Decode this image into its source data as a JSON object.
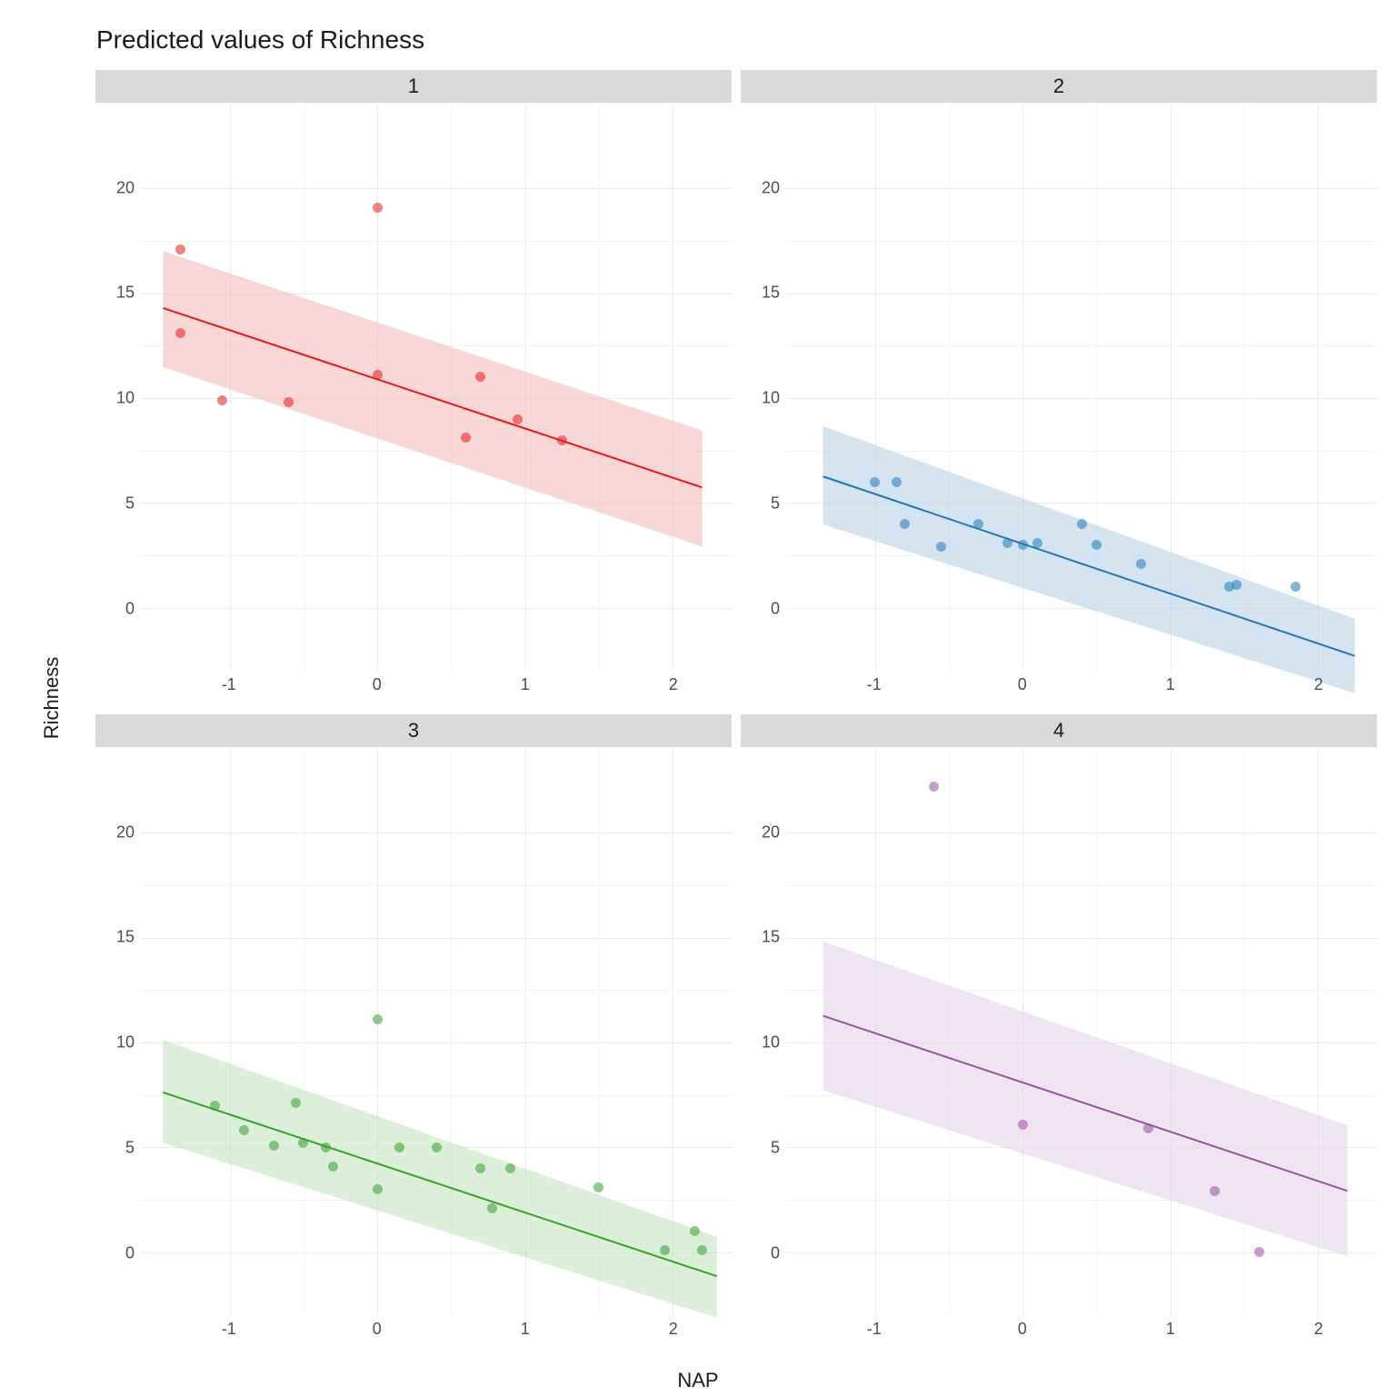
{
  "title": "Predicted values of Richness",
  "xlabel": "NAP",
  "ylabel": "Richness",
  "x_ticks": [
    -1,
    0,
    1,
    2
  ],
  "y_ticks": [
    0,
    5,
    10,
    15,
    20
  ],
  "x_range": [
    -1.6,
    2.4
  ],
  "y_range": [
    -3,
    24
  ],
  "colors": {
    "1": {
      "line": "#e31a1c",
      "fill": "#f7bdbd"
    },
    "2": {
      "line": "#1f78b4",
      "fill": "#b7d3e8"
    },
    "3": {
      "line": "#33a02c",
      "fill": "#c4e5bf"
    },
    "4": {
      "line": "#984ea3",
      "fill": "#e4d4ea"
    }
  },
  "chart_data": [
    {
      "facet": "1",
      "type": "scatter",
      "fit": {
        "x": [
          -1.45,
          2.2
        ],
        "y": [
          14.7,
          6.5
        ]
      },
      "ribbon": {
        "x": [
          -1.45,
          2.2
        ],
        "low": [
          12.0,
          3.8
        ],
        "high": [
          17.3,
          9.1
        ]
      },
      "points": [
        {
          "x": -1.33,
          "y": 17.1
        },
        {
          "x": -1.33,
          "y": 13.1
        },
        {
          "x": -1.05,
          "y": 9.9
        },
        {
          "x": -0.6,
          "y": 9.8
        },
        {
          "x": 0.0,
          "y": 19.1
        },
        {
          "x": 0.0,
          "y": 11.1
        },
        {
          "x": 0.6,
          "y": 8.1
        },
        {
          "x": 0.7,
          "y": 11.0
        },
        {
          "x": 0.95,
          "y": 9.0
        },
        {
          "x": 1.25,
          "y": 8.0
        }
      ]
    },
    {
      "facet": "2",
      "type": "scatter",
      "fit": {
        "x": [
          -1.35,
          2.25
        ],
        "y": [
          7.0,
          -1.2
        ]
      },
      "ribbon": {
        "x": [
          -1.35,
          2.25
        ],
        "low": [
          4.8,
          -2.9
        ],
        "high": [
          9.3,
          0.5
        ]
      },
      "points": [
        {
          "x": -1.0,
          "y": 6.0
        },
        {
          "x": -0.85,
          "y": 6.0
        },
        {
          "x": -0.8,
          "y": 4.0
        },
        {
          "x": -0.55,
          "y": 2.9
        },
        {
          "x": -0.3,
          "y": 4.0
        },
        {
          "x": -0.1,
          "y": 3.1
        },
        {
          "x": 0.0,
          "y": 3.0
        },
        {
          "x": 0.1,
          "y": 3.1
        },
        {
          "x": 0.4,
          "y": 4.0
        },
        {
          "x": 0.5,
          "y": 3.0
        },
        {
          "x": 0.8,
          "y": 2.1
        },
        {
          "x": 1.4,
          "y": 1.0
        },
        {
          "x": 1.45,
          "y": 1.1
        },
        {
          "x": 1.85,
          "y": 1.0
        }
      ]
    },
    {
      "facet": "3",
      "type": "scatter",
      "fit": {
        "x": [
          -1.45,
          2.3
        ],
        "y": [
          8.3,
          -0.1
        ]
      },
      "ribbon": {
        "x": [
          -1.45,
          2.3
        ],
        "low": [
          6.0,
          -2.0
        ],
        "high": [
          10.7,
          1.7
        ]
      },
      "points": [
        {
          "x": -1.1,
          "y": 7.0
        },
        {
          "x": -0.9,
          "y": 5.8
        },
        {
          "x": -0.7,
          "y": 5.1
        },
        {
          "x": -0.55,
          "y": 7.1
        },
        {
          "x": -0.5,
          "y": 5.2
        },
        {
          "x": -0.35,
          "y": 5.0
        },
        {
          "x": -0.3,
          "y": 4.1
        },
        {
          "x": 0.0,
          "y": 11.1
        },
        {
          "x": 0.0,
          "y": 3.0
        },
        {
          "x": 0.15,
          "y": 5.0
        },
        {
          "x": 0.4,
          "y": 5.0
        },
        {
          "x": 0.7,
          "y": 4.0
        },
        {
          "x": 0.78,
          "y": 2.1
        },
        {
          "x": 0.9,
          "y": 4.0
        },
        {
          "x": 1.5,
          "y": 3.1
        },
        {
          "x": 1.95,
          "y": 0.1
        },
        {
          "x": 2.15,
          "y": 1.0
        },
        {
          "x": 2.2,
          "y": 0.1
        }
      ]
    },
    {
      "facet": "4",
      "type": "scatter",
      "fit": {
        "x": [
          -1.35,
          2.2
        ],
        "y": [
          11.8,
          3.8
        ]
      },
      "ribbon": {
        "x": [
          -1.35,
          2.2
        ],
        "low": [
          8.4,
          0.8
        ],
        "high": [
          15.2,
          6.8
        ]
      },
      "points": [
        {
          "x": -0.6,
          "y": 22.2
        },
        {
          "x": 0.0,
          "y": 6.1
        },
        {
          "x": 0.85,
          "y": 5.9
        },
        {
          "x": 1.3,
          "y": 2.9
        },
        {
          "x": 1.6,
          "y": 0.0
        }
      ]
    }
  ]
}
